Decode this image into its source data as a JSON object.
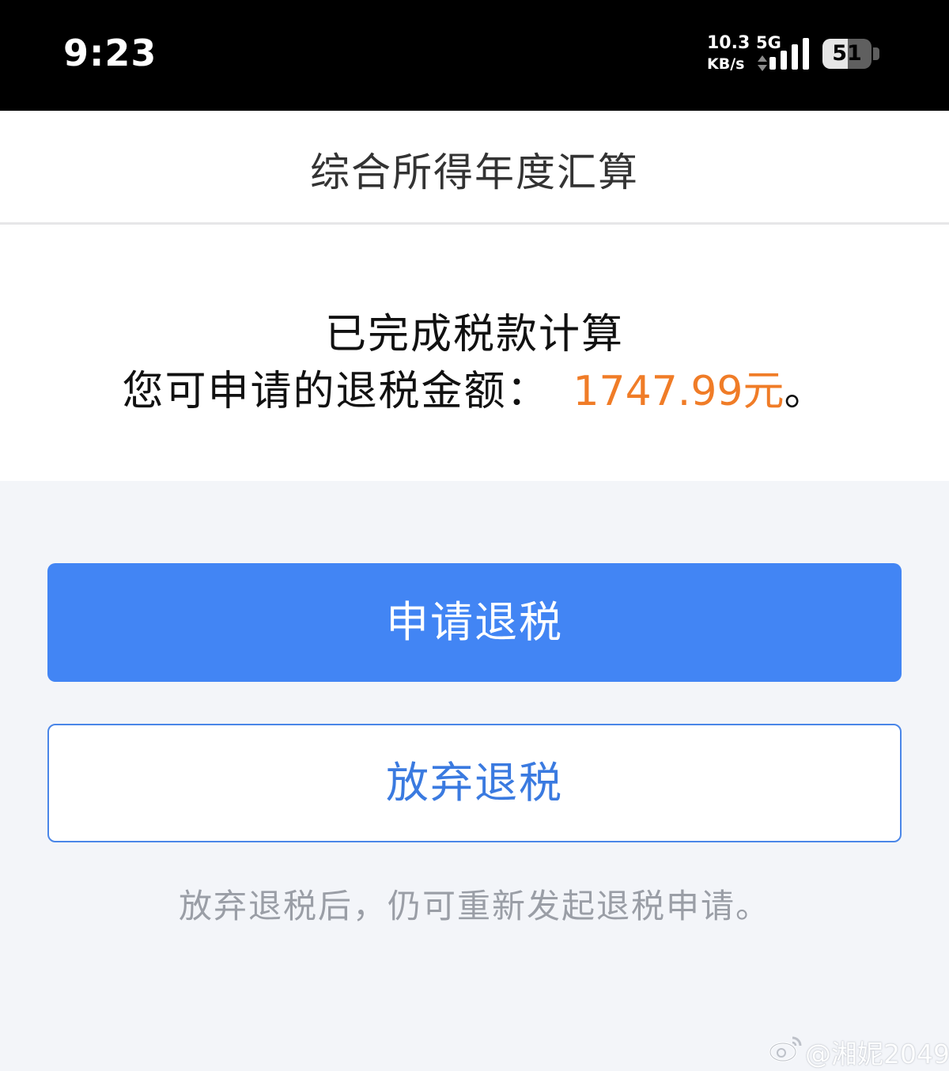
{
  "status_bar": {
    "time": "9:23",
    "net_speed_value": "10.3",
    "net_speed_unit": "KB/s",
    "network_type": "5G",
    "battery_percent": "51",
    "battery_level": 0.51,
    "signal_icon": "signal-bars-icon",
    "updown_icon": "data-activity-icon"
  },
  "header": {
    "title": "综合所得年度汇算"
  },
  "result": {
    "line1": "已完成税款计算",
    "line2_prefix": "您可申请的退税金额：",
    "amount": "1747.99元",
    "line2_suffix": "。"
  },
  "actions": {
    "apply_label": "申请退税",
    "abandon_label": "放弃退税"
  },
  "hint": "放弃退税后，仍可重新发起退税申请。",
  "watermark": {
    "text": "@湘妮2049",
    "icon": "weibo-logo-icon"
  },
  "colors": {
    "primary_button": "#4285f4",
    "secondary_border": "#4a86e8",
    "amount": "#f07c27",
    "hint": "#9a9ea6",
    "page_background": "#f3f5f9"
  }
}
